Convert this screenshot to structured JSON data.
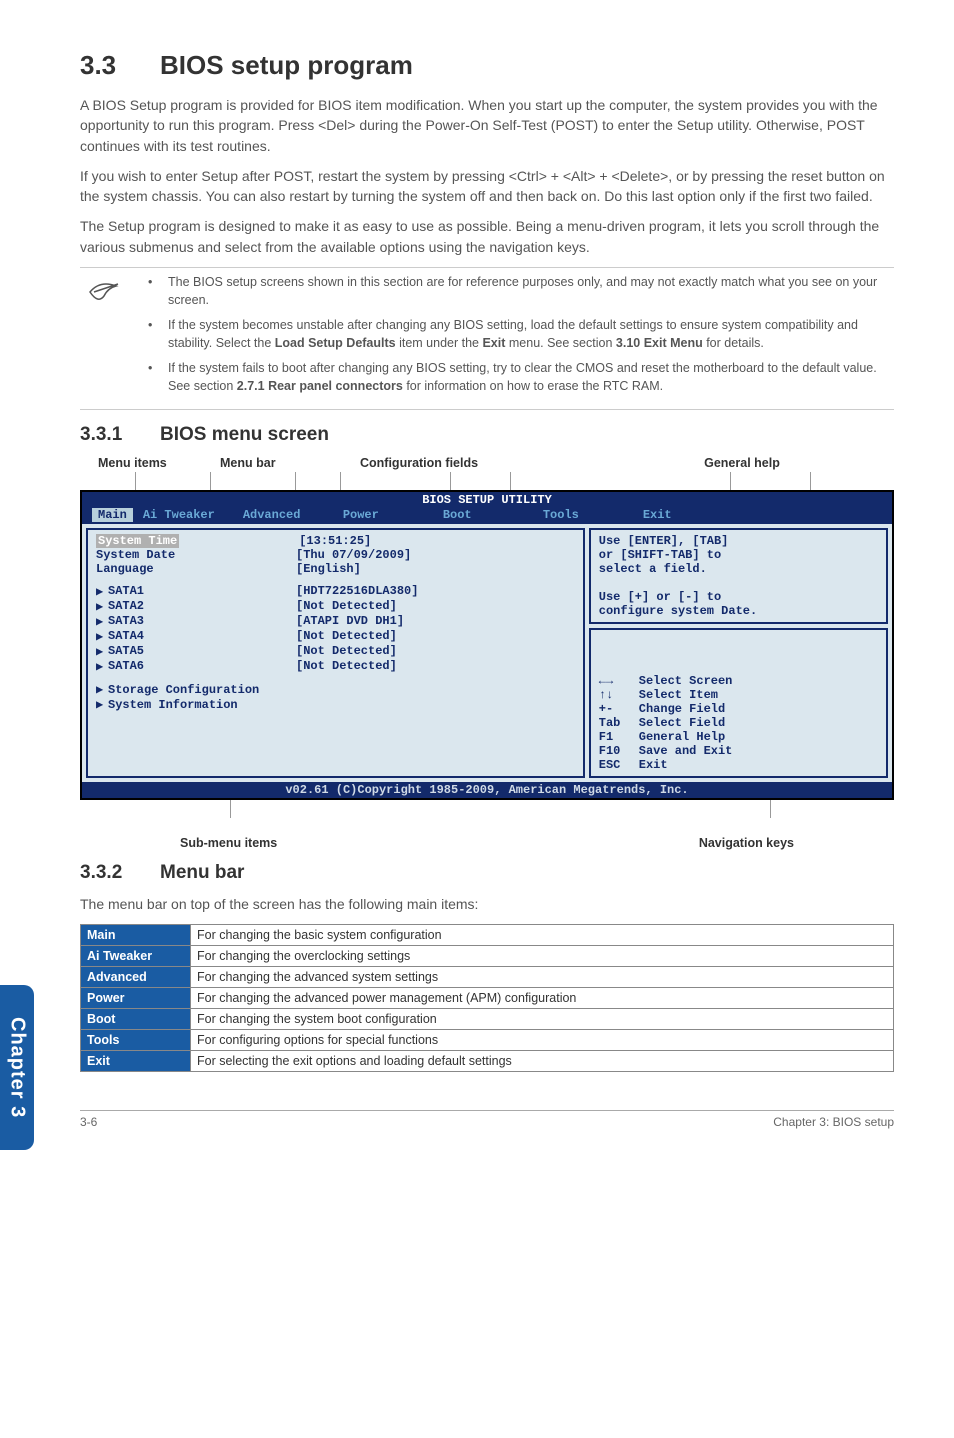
{
  "heading": {
    "num": "3.3",
    "title": "BIOS setup program"
  },
  "paragraphs": {
    "p1": "A BIOS Setup program is provided for BIOS item modification. When you start up the computer, the system provides you with the opportunity to run this program. Press <Del> during the Power-On Self-Test (POST) to enter the Setup utility. Otherwise, POST continues with its test routines.",
    "p2": "If you wish to enter Setup after POST, restart the system by pressing <Ctrl> + <Alt> + <Delete>, or by pressing the reset button on the system chassis. You can also restart by turning the system off and then back on. Do this last option only if the first two failed.",
    "p3": "The Setup program is designed to make it as easy to use as possible. Being a menu-driven program, it lets you scroll through the various submenus and select from the available options using the navigation keys."
  },
  "notes": [
    "The BIOS setup screens shown in this section are for reference purposes only, and may not exactly match what you see on your screen.",
    "If the system becomes unstable after changing any BIOS setting, load the default settings to ensure system compatibility and stability. Select the Load Setup Defaults item under the Exit menu. See section 3.10 Exit Menu for details.",
    "If the system fails to boot after changing any BIOS setting, try to clear the CMOS and reset the motherboard to the default value. See section 2.7.1 Rear panel connectors for information on how to erase the RTC RAM."
  ],
  "notes_bold": {
    "1": "Load Setup Defaults",
    "1b": "Exit",
    "1c": "3.10 Exit Menu",
    "2": "2.7.1 Rear panel connectors"
  },
  "sub1": {
    "num": "3.3.1",
    "title": "BIOS menu screen"
  },
  "sub2": {
    "num": "3.3.2",
    "title": "Menu bar"
  },
  "labels": {
    "menu_items": "Menu items",
    "menu_bar": "Menu bar",
    "config_fields": "Configuration fields",
    "general_help": "General help",
    "submenu": "Sub-menu items",
    "navkeys": "Navigation keys"
  },
  "bios": {
    "title": "BIOS SETUP UTILITY",
    "tabs": [
      "Main",
      "Ai Tweaker",
      "Advanced",
      "Power",
      "Boot",
      "Tools",
      "Exit"
    ],
    "rows_top": [
      {
        "label": "System Time",
        "value": "[13:51:25]",
        "selected": true
      },
      {
        "label": "System Date",
        "value": "[Thu 07/09/2009]"
      },
      {
        "label": "Language",
        "value": "[English]"
      }
    ],
    "sata": [
      {
        "label": "SATA1",
        "value": "[HDT722516DLA380]"
      },
      {
        "label": "SATA2",
        "value": "[Not Detected]"
      },
      {
        "label": "SATA3",
        "value": "[ATAPI DVD DH1]"
      },
      {
        "label": "SATA4",
        "value": "[Not Detected]"
      },
      {
        "label": "SATA5",
        "value": "[Not Detected]"
      },
      {
        "label": "SATA6",
        "value": "[Not Detected]"
      }
    ],
    "bottom_items": [
      "Storage Configuration",
      "System Information"
    ],
    "help_lines": [
      "Use [ENTER], [TAB]",
      "or [SHIFT-TAB] to",
      "select a field.",
      "",
      "Use [+] or [-] to",
      "configure system Date."
    ],
    "nav": [
      {
        "k": "←→",
        "d": "Select Screen"
      },
      {
        "k": "↑↓",
        "d": "Select Item"
      },
      {
        "k": "+-",
        "d": "Change Field"
      },
      {
        "k": "Tab",
        "d": "Select Field"
      },
      {
        "k": "F1",
        "d": "General Help"
      },
      {
        "k": "F10",
        "d": "Save and Exit"
      },
      {
        "k": "ESC",
        "d": "Exit"
      }
    ],
    "footer": "v02.61 (C)Copyright 1985-2009, American Megatrends, Inc."
  },
  "menubar_desc": "The menu bar on top of the screen has the following main items:",
  "menu_table": [
    {
      "name": "Main",
      "desc": "For changing the basic system configuration"
    },
    {
      "name": "Ai Tweaker",
      "desc": "For changing the overclocking settings"
    },
    {
      "name": "Advanced",
      "desc": "For changing the advanced system settings"
    },
    {
      "name": "Power",
      "desc": "For changing the advanced power management (APM) configuration"
    },
    {
      "name": "Boot",
      "desc": "For changing the system boot configuration"
    },
    {
      "name": "Tools",
      "desc": "For configuring options for special functions"
    },
    {
      "name": "Exit",
      "desc": "For selecting the exit options and loading default settings"
    }
  ],
  "side_tab": "Chapter 3",
  "footer": {
    "left": "3-6",
    "right": "Chapter 3: BIOS setup"
  }
}
